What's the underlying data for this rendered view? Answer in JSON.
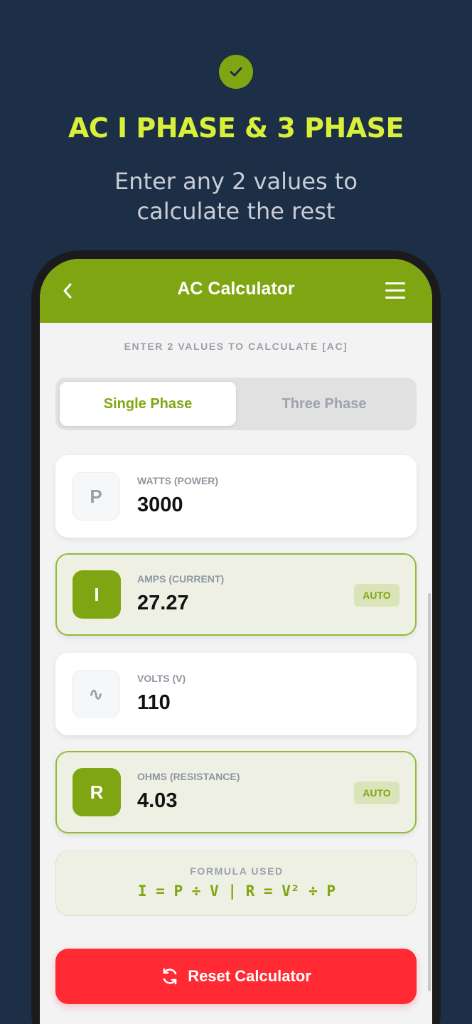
{
  "promo": {
    "headline": "AC I PHASE & 3 PHASE",
    "subline": "Enter any 2 values to\ncalculate the rest",
    "badge_icon": "check-icon"
  },
  "app": {
    "title": "AC Calculator",
    "back_icon": "chevron-left-icon",
    "menu_icon": "hamburger-menu-icon",
    "section_label": "ENTER 2 VALUES TO CALCULATE [AC]"
  },
  "phase_tabs": [
    {
      "label": "Single Phase",
      "active": true
    },
    {
      "label": "Three Phase",
      "active": false
    }
  ],
  "fields": [
    {
      "symbol": "P",
      "label": "WATTS (POWER)",
      "value": "3000"
    },
    {
      "symbol": "I",
      "label": "AMPS (CURRENT)",
      "value": "27.27",
      "badge": "AUTO"
    },
    {
      "symbol": "∿",
      "label": "VOLTS (V)",
      "value": "110"
    },
    {
      "symbol": "R",
      "label": "OHMS (RESISTANCE)",
      "value": "4.03",
      "badge": "AUTO"
    }
  ],
  "formula": {
    "label": "FORMULA USED",
    "expression": "I = P ÷ V | R = V² ÷ P"
  },
  "reset": {
    "label": "Reset Calculator",
    "icon": "refresh-icon"
  },
  "colors": {
    "background": "#1d2e47",
    "accent": "#7fa612",
    "headline": "#d8f03a",
    "danger": "#ff2a33"
  }
}
